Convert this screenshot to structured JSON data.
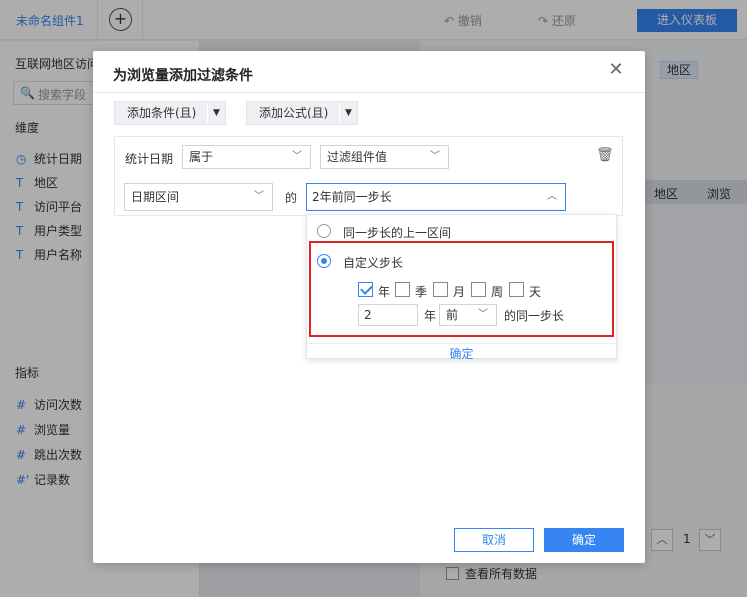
{
  "app": {
    "component_tab": "未命名组件1",
    "add_tab_icon": "plus-circle-icon",
    "undo_label": "撤销",
    "redo_label": "还原",
    "enter_dashboard": "进入仪表板"
  },
  "left_panel": {
    "dataset_title": "互联网地区访问",
    "search_placeholder": "搜索字段",
    "dimension_header": "维度",
    "dimensions": [
      {
        "icon": "clock-icon",
        "glyph": "◷",
        "label": "统计日期"
      },
      {
        "icon": "text-type-icon",
        "glyph": "T",
        "label": "地区"
      },
      {
        "icon": "text-type-icon",
        "glyph": "T",
        "label": "访问平台"
      },
      {
        "icon": "text-type-icon",
        "glyph": "T",
        "label": "用户类型"
      },
      {
        "icon": "text-type-icon",
        "glyph": "T",
        "label": "用户名称"
      }
    ],
    "metric_header": "指标",
    "metrics": [
      {
        "icon": "number-icon",
        "glyph": "#",
        "label": "访问次数"
      },
      {
        "icon": "number-icon",
        "glyph": "#",
        "label": "浏览量"
      },
      {
        "icon": "number-icon",
        "glyph": "#",
        "label": "跳出次数"
      },
      {
        "icon": "number-icon",
        "glyph": "#'",
        "label": "记录数"
      }
    ]
  },
  "right_panel": {
    "chip_label": "地区",
    "table_columns": [
      "地区",
      "浏览"
    ],
    "page_number": "1",
    "show_all_label": "查看所有数据"
  },
  "modal": {
    "title": "为浏览量添加过滤条件",
    "add_condition": "添加条件(且)",
    "add_formula": "添加公式(且)",
    "condition": {
      "field_label": "统计日期",
      "operator": "属于",
      "value_type": "过滤组件值",
      "range_type": "日期区间",
      "of_label": "的",
      "value": "2年前同一步长"
    },
    "dropdown": {
      "option1": "同一步长的上一区间",
      "option2": "自定义步长",
      "selected_option": 2,
      "units": [
        {
          "label": "年",
          "checked": true
        },
        {
          "label": "季",
          "checked": false
        },
        {
          "label": "月",
          "checked": false
        },
        {
          "label": "周",
          "checked": false
        },
        {
          "label": "天",
          "checked": false
        }
      ],
      "amount": "2",
      "amount_unit": "年",
      "direction": "前",
      "suffix": "的同一步长",
      "confirm": "确定"
    },
    "cancel_label": "取消",
    "ok_label": "确定"
  }
}
